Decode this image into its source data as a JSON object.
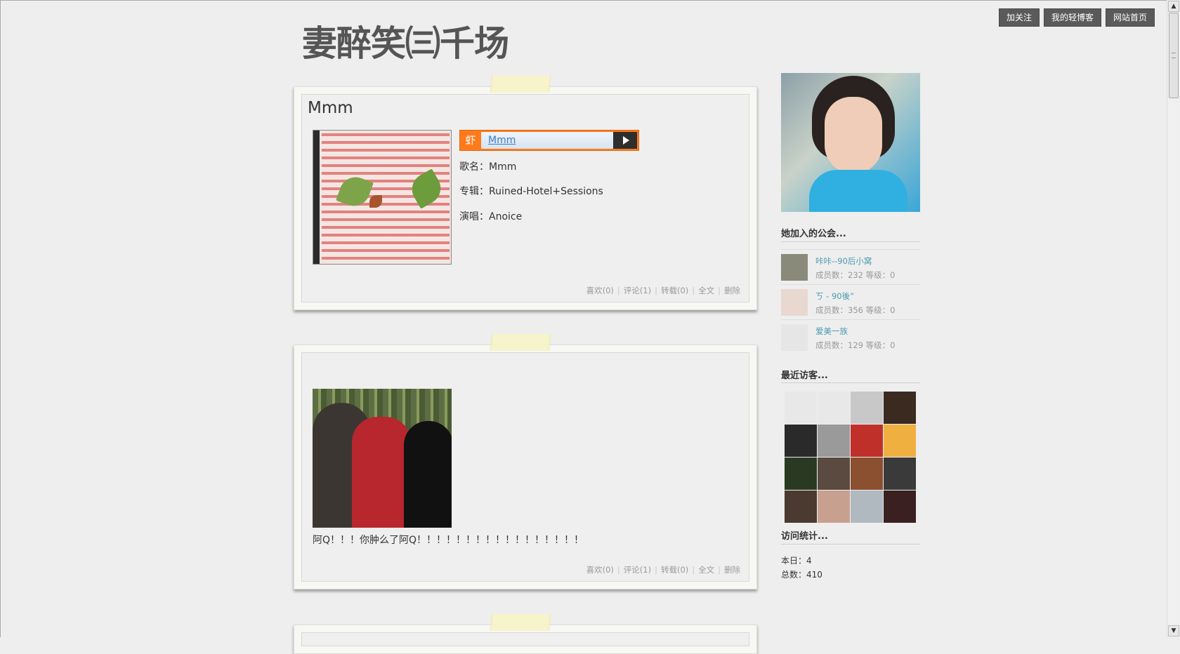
{
  "header": {
    "blog_title": "妻醉笑㈢千场",
    "nav": [
      "加关注",
      "我的轻博客",
      "网站首页"
    ]
  },
  "posts": [
    {
      "title": "Mmm",
      "player": {
        "logo": "虾",
        "track": "Mmm"
      },
      "song_line": "歌名：Mmm",
      "album_line": "专辑：Ruined-Hotel+Sessions",
      "artist_line": "演唱：Anoice",
      "actions": {
        "like": "喜欢(0)",
        "comment": "评论(1)",
        "repost": "转载(0)",
        "full": "全文",
        "delete": "删除"
      }
    },
    {
      "caption": "阿Q！！！你肿么了阿Q！！！！！！！！！！！！！！！！！",
      "actions": {
        "like": "喜欢(0)",
        "comment": "评论(1)",
        "repost": "转载(0)",
        "full": "全文",
        "delete": "删除"
      }
    }
  ],
  "sidebar": {
    "clubs_heading": "她加入的公会...",
    "clubs": [
      {
        "name": "咔咔--90后小窝",
        "stats": "成员数：232 等级：0",
        "thumb_color": "#8a8a7a"
      },
      {
        "name": "ㄎ - 90後”",
        "stats": "成员数：356 等级：0",
        "thumb_color": "#e8d8d0"
      },
      {
        "name": "爱美一族",
        "stats": "成员数：129 等级：0",
        "thumb_color": "#e6e6e6"
      }
    ],
    "visitors_heading": "最近访客...",
    "visitor_colors": [
      "#e8e8e8",
      "#e8e8e8",
      "#c8c8c8",
      "#3a2a20",
      "#2a2a2a",
      "#9a9a9a",
      "#c0302a",
      "#f0b040",
      "#2a3a22",
      "#5a4a40",
      "#8a5030",
      "#3a3a3a",
      "#4a3a30",
      "#c8a090",
      "#b0b8c0",
      "#3a2020"
    ],
    "stats_heading": "访问统计...",
    "today": "本日：4",
    "total": "总数：410"
  },
  "colors": {
    "background": "#eeeeee",
    "nav_bg": "#5a5a5a",
    "link": "#4a9ab0",
    "player_accent": "#ff7a1a"
  }
}
